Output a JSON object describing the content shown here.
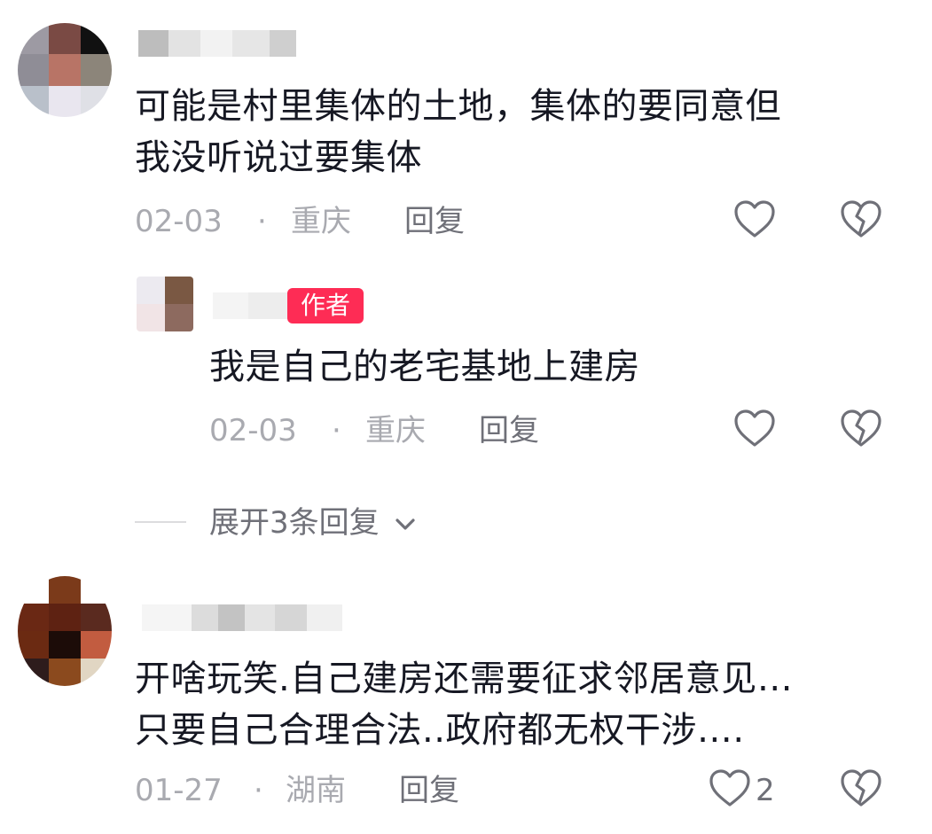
{
  "comments": [
    {
      "text_line1": "可能是村里集体的土地，集体的要同意但",
      "text_line2": "我没听说过要集体",
      "date": "02-03",
      "separator": "·",
      "location": "重庆",
      "reply_label": "回复",
      "like_icon": "heart-outline-icon",
      "dislike_icon": "broken-heart-icon"
    },
    {
      "text_line1": "开啥玩笑.自己建房还需要征求邻居意见…",
      "text_line2": "只要自己合理合法..政府都无权干涉….",
      "date": "01-27",
      "separator": "·",
      "location": "湖南",
      "reply_label": "回复",
      "like_count": "2",
      "like_icon": "heart-outline-icon",
      "dislike_icon": "broken-heart-icon"
    }
  ],
  "author_reply": {
    "badge": "作者",
    "text": "我是自己的老宅基地上建房",
    "date": "02-03",
    "separator": "·",
    "location": "重庆",
    "reply_label": "回复"
  },
  "expand": {
    "label": "展开3条回复",
    "icon": "chevron-down-icon"
  },
  "colors": {
    "text": "#161823",
    "meta": "#a9aab0",
    "reply": "#6f7078",
    "author_badge": "#fe2c55"
  }
}
